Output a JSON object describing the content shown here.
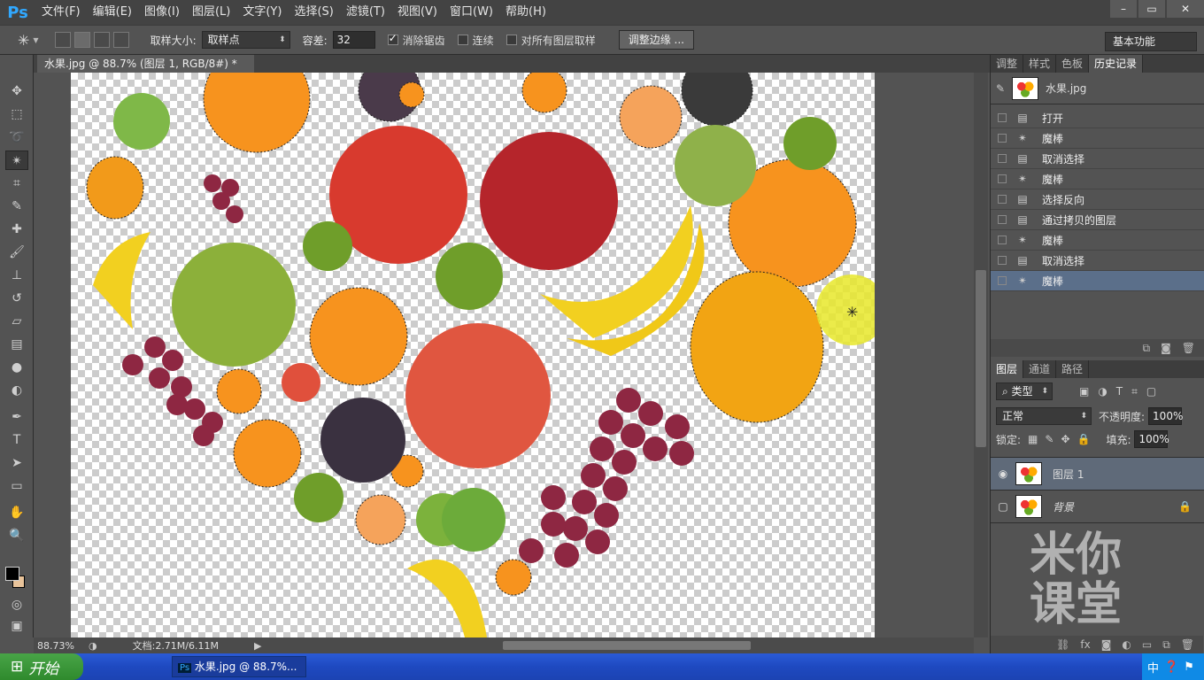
{
  "app": {
    "logo": "Ps"
  },
  "menu": [
    "文件(F)",
    "编辑(E)",
    "图像(I)",
    "图层(L)",
    "文字(Y)",
    "选择(S)",
    "滤镜(T)",
    "视图(V)",
    "窗口(W)",
    "帮助(H)"
  ],
  "window_controls": {
    "min": "–",
    "max": "▭",
    "close": "✕"
  },
  "options": {
    "sample_size_label": "取样大小:",
    "sample_size_value": "取样点",
    "tolerance_label": "容差:",
    "tolerance_value": "32",
    "antialias_label": "消除锯齿",
    "contiguous_label": "连续",
    "all_layers_label": "对所有图层取样",
    "refine_edge_button": "调整边缘 ...",
    "workspace": "基本功能"
  },
  "document": {
    "tab_title": "水果.jpg @ 88.7% (图层 1, RGB/8#) *",
    "close": "×"
  },
  "status": {
    "zoom": "88.73%",
    "doc_info": "文档:2.71M/6.11M"
  },
  "history_panel": {
    "tabs": [
      "调整",
      "样式",
      "色板",
      "历史记录"
    ],
    "active_tab": "历史记录",
    "snapshot": "水果.jpg",
    "items": [
      "打开",
      "魔棒",
      "取消选择",
      "魔棒",
      "选择反向",
      "通过拷贝的图层",
      "魔棒",
      "取消选择",
      "魔棒"
    ]
  },
  "layers_panel": {
    "tabs": [
      "图层",
      "通道",
      "路径"
    ],
    "active_tab": "图层",
    "filter": "类型",
    "blend_mode": "正常",
    "opacity_label": "不透明度:",
    "opacity_value": "100%",
    "lock_label": "锁定:",
    "fill_label": "填充:",
    "fill_value": "100%",
    "layers": [
      {
        "name": "图层 1",
        "visible": true,
        "active": true
      },
      {
        "name": "背景",
        "visible": false,
        "active": false,
        "locked": true
      }
    ]
  },
  "watermark": [
    "米你",
    "课堂"
  ],
  "taskbar": {
    "start": "开始",
    "task": "水果.jpg @ 88.7%...",
    "ime": "中"
  }
}
